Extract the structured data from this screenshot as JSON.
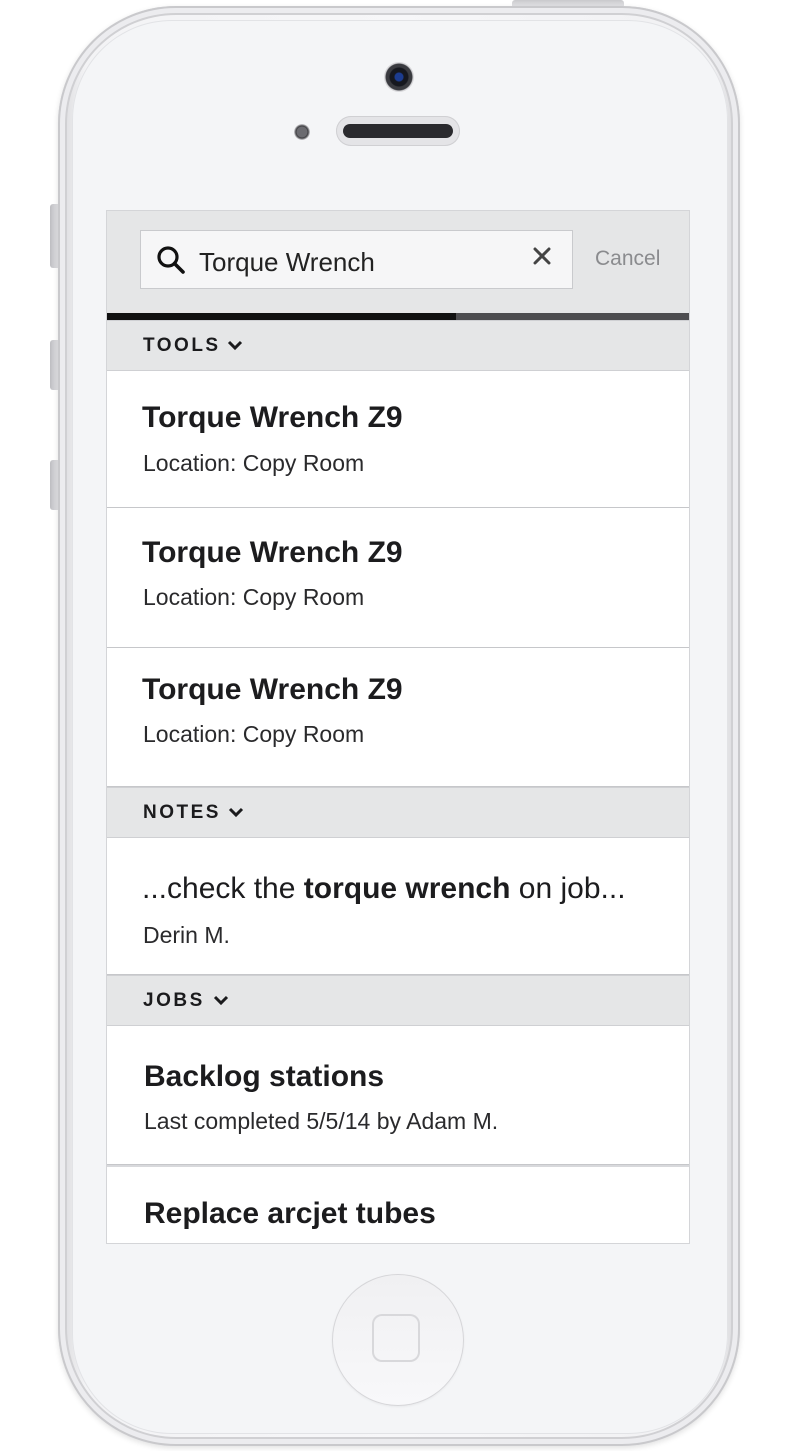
{
  "search": {
    "query": "Torque Wrench",
    "cancel_label": "Cancel",
    "progress": 0.6
  },
  "sections": {
    "tools": {
      "label": "TOOLS",
      "items": [
        {
          "title": "Torque Wrench Z9",
          "subtitle": "Location: Copy Room"
        },
        {
          "title": "Torque Wrench Z9",
          "subtitle": "Location: Copy Room"
        },
        {
          "title": "Torque Wrench Z9",
          "subtitle": "Location: Copy Room"
        }
      ]
    },
    "notes": {
      "label": "NOTES",
      "items": [
        {
          "text_before": "...check the ",
          "text_highlight": "torque wrench",
          "text_after": " on job...",
          "author": "Derin M."
        }
      ]
    },
    "jobs": {
      "label": "JOBS",
      "items": [
        {
          "title": "Backlog stations",
          "subtitle": "Last completed 5/5/14 by Adam M."
        },
        {
          "title": "Replace arcjet tubes",
          "subtitle": ""
        }
      ]
    }
  },
  "icons": {
    "search": "search-icon",
    "clear": "close-icon",
    "expand": "chevron-down-icon"
  }
}
